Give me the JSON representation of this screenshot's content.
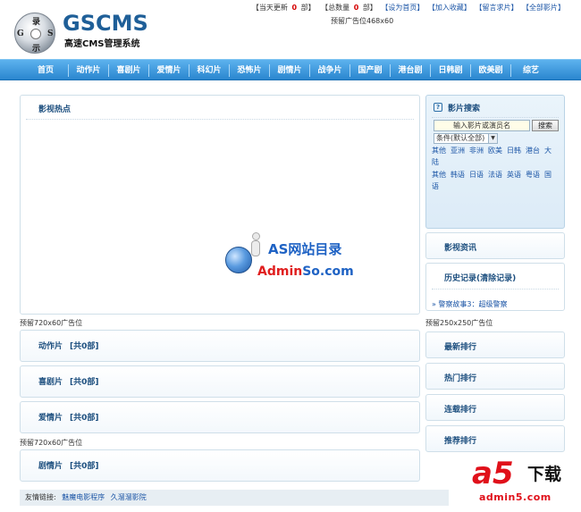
{
  "header": {
    "disc_chars": [
      "录",
      "G",
      "S",
      "示"
    ],
    "title": "GSCMS",
    "subtitle": "高速CMS管理系统",
    "ad_top": "预留广告位468x60",
    "stats": {
      "today_prefix": "【当天更新",
      "today_count": "0",
      "today_suffix": "部】",
      "total_prefix": "【总数量",
      "total_count": "0",
      "total_suffix": "部】"
    },
    "links": [
      "【设为首页】",
      "【加入收藏】",
      "【留言求片】",
      "【全部影片】"
    ]
  },
  "nav": {
    "items": [
      "首页",
      "动作片",
      "喜剧片",
      "爱情片",
      "科幻片",
      "恐怖片",
      "剧情片",
      "战争片",
      "国产剧",
      "港台剧",
      "日韩剧",
      "欧美剧",
      "综艺"
    ]
  },
  "main": {
    "hot_title": "影视热点",
    "ad_720_a": "预留720x60广告位",
    "ad_720_b": "预留720x60广告位",
    "bars": [
      {
        "title": "动作片",
        "count": "[共0部]"
      },
      {
        "title": "喜剧片",
        "count": "[共0部]"
      },
      {
        "title": "爱情片",
        "count": "[共0部]"
      },
      {
        "title": "剧情片",
        "count": "[共0部]"
      }
    ]
  },
  "sidebar": {
    "search_title": "影片搜索",
    "search_placeholder": "输入影片或演员名",
    "search_button": "搜索",
    "condition_select": "条件(默认全部)",
    "regions": [
      "其他",
      "亚洲",
      "非洲",
      "欧美",
      "日韩",
      "港台",
      "大陆"
    ],
    "languages": [
      "其他",
      "韩语",
      "日语",
      "法语",
      "英语",
      "粤语",
      "国语"
    ],
    "news_title": "影视资讯",
    "history_title": "历史记录",
    "history_clear": "(清除记录)",
    "history_item": "» 警察故事3：超级警察",
    "ad_250": "预留250x250广告位",
    "rank_boxes": [
      "最新排行",
      "热门排行",
      "连载排行",
      "推荐排行"
    ]
  },
  "footer": {
    "label": "友情链接:",
    "links": [
      "魅魔电影程序",
      "久溜溜影院"
    ]
  },
  "watermarks": {
    "as_title": "AS网站目录",
    "as_domain_red": "Admin",
    "as_domain_blue": "So.com",
    "a5_big": "a5",
    "a5_cn": "下载",
    "a5_domain": "admin5.com"
  }
}
